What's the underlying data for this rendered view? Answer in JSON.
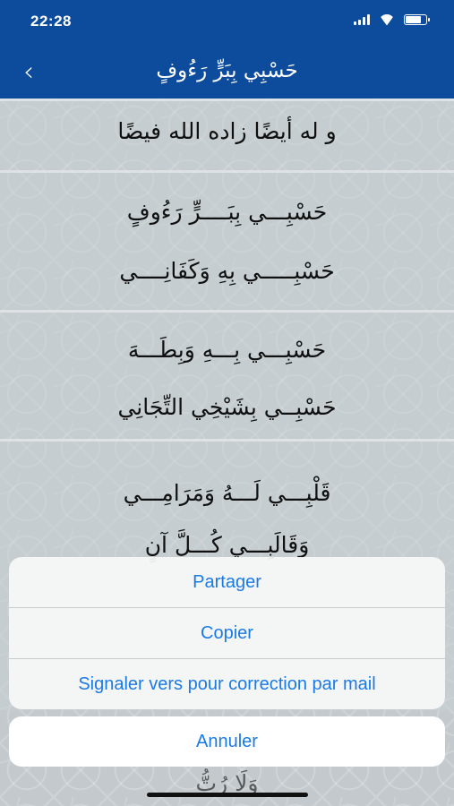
{
  "status_bar": {
    "time": "22:28",
    "signal_icon": "signal-icon",
    "wifi_icon": "wifi-icon",
    "battery_icon": "battery-icon"
  },
  "nav": {
    "back_icon": "chevron-left-icon",
    "title": "حَسْبِي بِبَرٍّ رَءُوفٍ"
  },
  "poem": {
    "intro": "و له أيضًا زاده الله فيضًا",
    "verses": [
      {
        "line1": "حَسْبِـــي بِبَــــرٍّ رَءُوفٍ",
        "line2": "حَسْبِـــــي بِهِ وَكَفَانِــــي"
      },
      {
        "line1": "حَسْبِـــي بِـــهِ وَبِطَـــهَ",
        "line2": "حَسْبِــي بِشَيْخِي التِّجَانِي"
      },
      {
        "line1": "قَلْبِـــي لَـــهُ وَمَرَامِـــي",
        "line2": "وَقَالَبِـــي كُـــلَّ آنٍ"
      }
    ],
    "partial_bottom": "وَلَا رُتُّ"
  },
  "action_sheet": {
    "share": "Partager",
    "copy": "Copier",
    "report": "Signaler vers pour correction par mail",
    "cancel": "Annuler"
  },
  "colors": {
    "nav": "#0d4b9c",
    "action_text": "#1a7ae6"
  }
}
